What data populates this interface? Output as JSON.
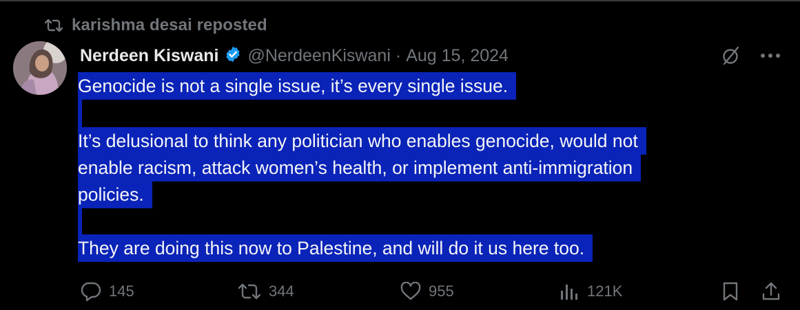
{
  "repost": {
    "icon": "repost-icon",
    "label": "karishma desai reposted"
  },
  "author": {
    "name": "Nerdeen Kiswani",
    "handle": "@NerdeenKiswani",
    "date": "Aug 15, 2024",
    "separator": "·",
    "verified_icon": "verified-badge-icon"
  },
  "header_actions": {
    "grok_icon": "slash-circle-icon",
    "more_icon": "more-dots-icon",
    "more_label": "···"
  },
  "tweet": {
    "lines": [
      "Genocide is not a single issue, it’s every single issue.",
      "",
      "It’s delusional to think any politician who enables genocide, would not",
      "enable racism, attack women’s health, or implement anti-immigration",
      "policies.",
      "",
      "They are doing this now to Palestine, and will do it us here too."
    ]
  },
  "stats": {
    "replies": "145",
    "reposts": "344",
    "likes": "955",
    "views": "121K"
  },
  "colors": {
    "background": "#000000",
    "highlight": "#0a23b8",
    "muted": "#71767b",
    "verified": "#1d9bf0"
  }
}
